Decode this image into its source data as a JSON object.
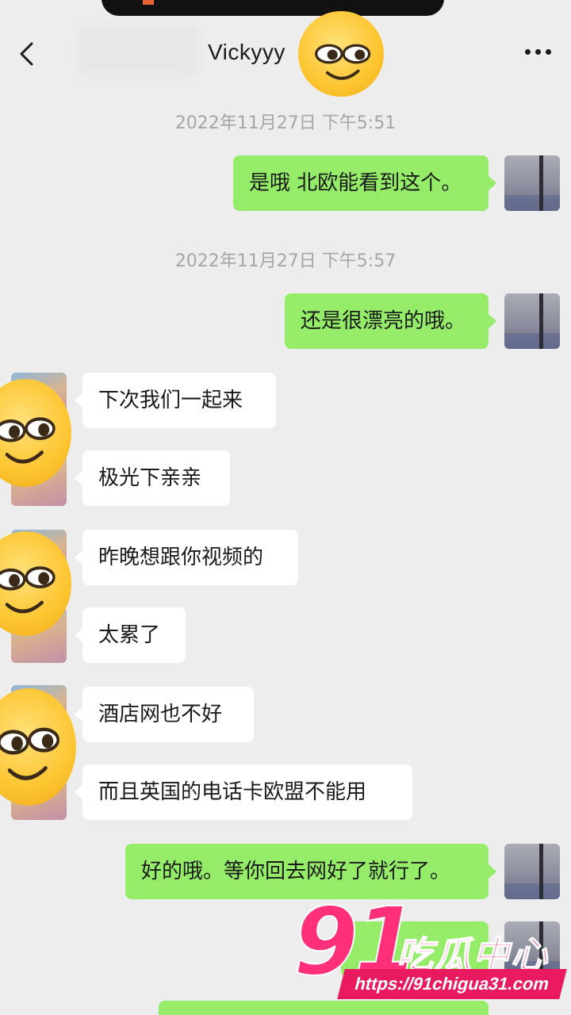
{
  "header": {
    "title": "Vickyyy",
    "back_icon": "chevron-left-icon",
    "more_icon": "more-dots-icon"
  },
  "timestamps": [
    "2022年11月27日 下午5:51",
    "2022年11月27日 下午5:57"
  ],
  "messages": {
    "out1": "是哦 北欧能看到这个。",
    "out2": "还是很漂亮的哦。",
    "in1": "下次我们一起来",
    "in2": "极光下亲亲",
    "in3": "昨晚想跟你视频的",
    "in4": "太累了",
    "in5": "酒店网也不好",
    "in6": "而且英国的电话卡欧盟不能用",
    "out3": "好的哦。等你回去网好了就行了。"
  },
  "watermark": {
    "number": "91",
    "name": "吃瓜中心",
    "url": "https://91chigua31.com"
  },
  "colors": {
    "background": "#ededed",
    "outgoing_bubble": "#95ec69",
    "incoming_bubble": "#ffffff",
    "watermark": "#ff2f7a"
  }
}
